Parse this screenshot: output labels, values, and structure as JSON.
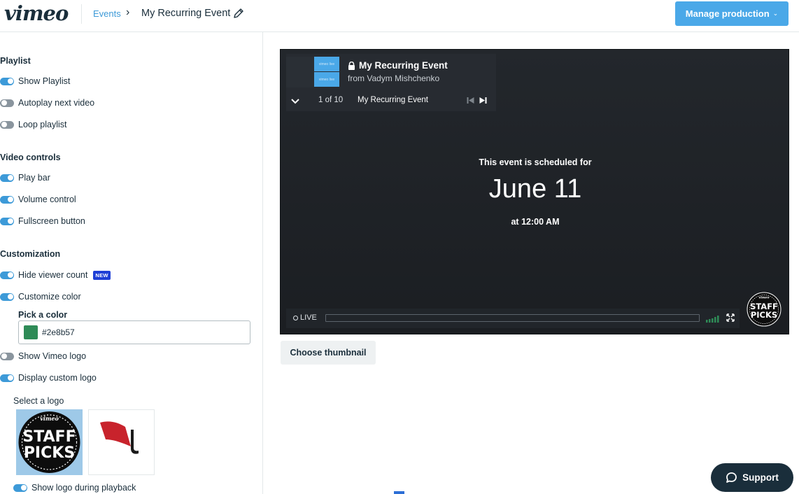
{
  "header": {
    "logo_text": "vimeo",
    "breadcrumb_link": "Events",
    "breadcrumb_separator": "›",
    "event_title": "My Recurring Event",
    "manage_label": "Manage production",
    "manage_chevron": "⌄"
  },
  "sidebar": {
    "sections": {
      "playlist": "Playlist",
      "video_controls": "Video controls",
      "customization": "Customization"
    },
    "options": {
      "show_playlist": {
        "label": "Show Playlist",
        "on": true
      },
      "autoplay_next": {
        "label": "Autoplay next video",
        "on": false
      },
      "loop_playlist": {
        "label": "Loop playlist",
        "on": false
      },
      "play_bar": {
        "label": "Play bar",
        "on": true
      },
      "volume_control": {
        "label": "Volume control",
        "on": true
      },
      "fullscreen_button": {
        "label": "Fullscreen button",
        "on": true
      },
      "hide_viewer_count": {
        "label": "Hide viewer count",
        "on": true
      },
      "customize_color": {
        "label": "Customize color",
        "on": true
      },
      "show_vimeo_logo": {
        "label": "Show Vimeo logo",
        "on": false
      },
      "display_custom_logo": {
        "label": "Display custom logo",
        "on": true
      },
      "show_logo_playback": {
        "label": "Show logo during playback",
        "on": true
      }
    },
    "new_badge": "NEW",
    "pick_color_label": "Pick a color",
    "color_value": "#2e8b57",
    "select_logo_label": "Select a logo",
    "logo_text_top": "vimeo",
    "logo_text_main1": "STAFF",
    "logo_text_main2": "PICKS"
  },
  "player": {
    "playlist_title": "My Recurring Event",
    "playlist_owner": "from Vadym Mishchenko",
    "thumb_label": "vimeo live",
    "position": "1 of 10",
    "current_item": "My Recurring Event",
    "schedule_heading": "This event is scheduled for",
    "schedule_date": "June 11",
    "schedule_time": "at 12:00 AM",
    "live_label": "LIVE",
    "badge_top": "vimeo",
    "badge_main1": "STAFF",
    "badge_main2": "PICKS"
  },
  "actions": {
    "choose_thumbnail": "Choose thumbnail",
    "support": "Support"
  },
  "colors": {
    "accent": "#3d9ad8",
    "manage_button": "#4aa8e8",
    "custom_color": "#2e8b57",
    "support_bg": "#1a2e3b",
    "new_badge": "#1f3fd6",
    "volume_bars": "#2e8b57"
  }
}
